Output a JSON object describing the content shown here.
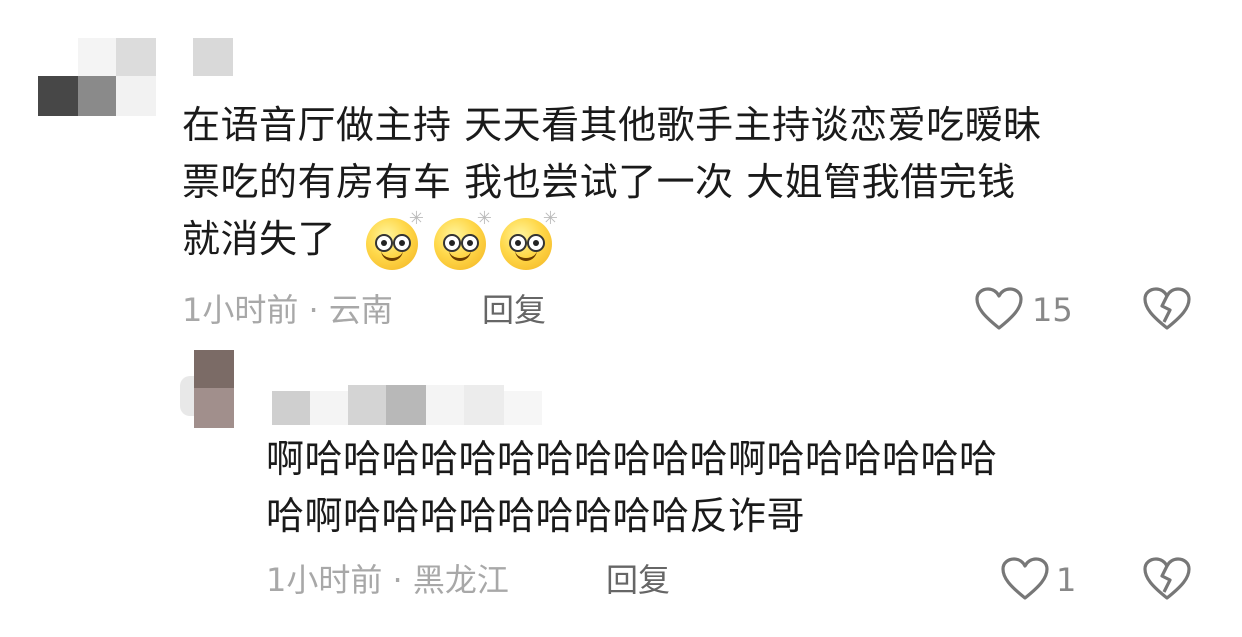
{
  "comments": [
    {
      "text_lines": [
        "在语音厅做主持 天天看其他歌手主持谈恋爱吃暧昧",
        "票吃的有房有车 我也尝试了一次 大姐管我借完钱",
        "就消失了"
      ],
      "emoji": "dizzy-face-emoji",
      "time_location": "1小时前 · 云南",
      "reply_label": "回复",
      "like_count": "15"
    },
    {
      "text_lines": [
        "啊哈哈哈哈哈哈哈哈哈哈哈啊哈哈哈哈哈哈",
        "哈啊哈哈哈哈哈哈哈哈哈反诈哥"
      ],
      "time_location": "1小时前 · 黑龙江",
      "reply_label": "回复",
      "like_count": "1"
    }
  ],
  "colors": {
    "text": "#1a1a1a",
    "meta": "#a8a8a8",
    "icon": "#777777"
  }
}
